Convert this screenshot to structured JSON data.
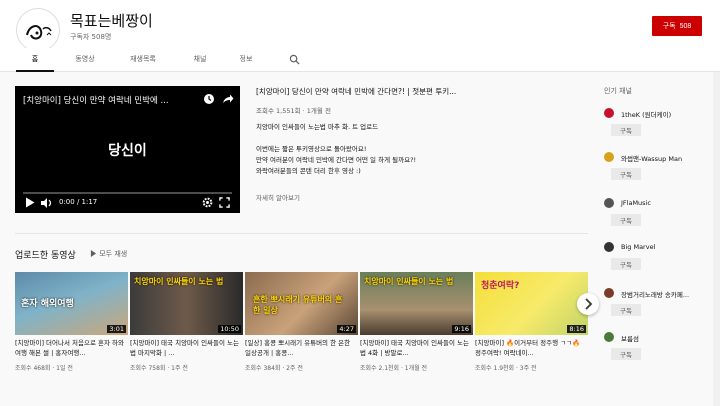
{
  "channel": {
    "name": "목표는베짱이",
    "subscribers": "구독자 508명",
    "subscribe_label": "구독",
    "subscribe_count": "508"
  },
  "tabs": [
    {
      "label": "홈",
      "active": true
    },
    {
      "label": "동영상",
      "active": false
    },
    {
      "label": "재생목록",
      "active": false
    },
    {
      "label": "채널",
      "active": false
    },
    {
      "label": "정보",
      "active": false
    }
  ],
  "player": {
    "title": "[치앙마이] 당신이 만약 여락네 민박에 ...",
    "center_text": "당신이",
    "time": "0:00 / 1:17",
    "progress": 0
  },
  "video_info": {
    "title": "[치앙마이] 당신이 만약 여락네 민박에 간다면?! | 젓분편 투키...",
    "meta": "조회수 1,551회 · 1개월 전",
    "desc": [
      "치앙마이 인싸들이 노는법 마추 화. 트 업로드",
      "",
      "이번에는 짧은 투키영상으로 돌아왔어요!",
      "만약 여러분이 여락네 민박에 간다면 어떤 일 하게 될까요?!",
      "와락여러분들의 콘텐 더리 한후 영상 :)"
    ],
    "more": "자세히 알아보기"
  },
  "uploads": {
    "title": "업로드한 동영상",
    "play_all": "모두 재생",
    "cards": [
      {
        "title": "[치앙마이] 더어나서 처음으로 혼자 하와여행 해본 썰 | 홍자여행...",
        "meta": "조회수 468회 · 1일 전",
        "duration": "3:01",
        "thumb_text": "혼자 해외여행"
      },
      {
        "title": "[치앙마이] 태국 치앙마이 인싸들이 노는법 마지막화 | ...",
        "meta": "조회수 758회 · 1주 전",
        "duration": "10:50",
        "thumb_text": "치앙마이 인싸들이 노는 법"
      },
      {
        "title": "[일상] 홍콩 뽀시래기 유튜버의 한 은한 일상공개 | 홍콩...",
        "meta": "조회수 384회 · 2주 전",
        "duration": "4:27",
        "thumb_text": "흔한 뽀시래기 유튜버의 흔한 일상"
      },
      {
        "title": "[치앙마이] 태국 치앙마이 인싸들이 노는법 4화 | 방말로...",
        "meta": "조회수 2.1천회 · 1개월 전",
        "duration": "9:16",
        "thumb_text": "치앙마이 인싸들이 노는 법"
      },
      {
        "title": "[치앙마이] 🔥이거부터 정주행 ㄱㄱ🔥 정주여락! 여락네이...",
        "meta": "조회수 1.9천회 · 3주 전",
        "duration": "8:16",
        "thumb_text": "청춘여락?"
      }
    ]
  },
  "sidebar": {
    "title": "인기 채널",
    "subscribe_label": "구독",
    "channels": [
      {
        "name": "1theK (원더케이)",
        "color": "#c8102e"
      },
      {
        "name": "와썹맨-Wassup Man",
        "color": "#d6a31a"
      },
      {
        "name": "JFlaMusic",
        "color": "#555555"
      },
      {
        "name": "Big Marvel",
        "color": "#333333"
      },
      {
        "name": "장범거리노래방 송카페...",
        "color": "#7a3b2a"
      },
      {
        "name": "보름섬",
        "color": "#4a7a3b"
      }
    ]
  },
  "colors": {
    "accent": "#cc0000",
    "player_bg": "#000000"
  }
}
